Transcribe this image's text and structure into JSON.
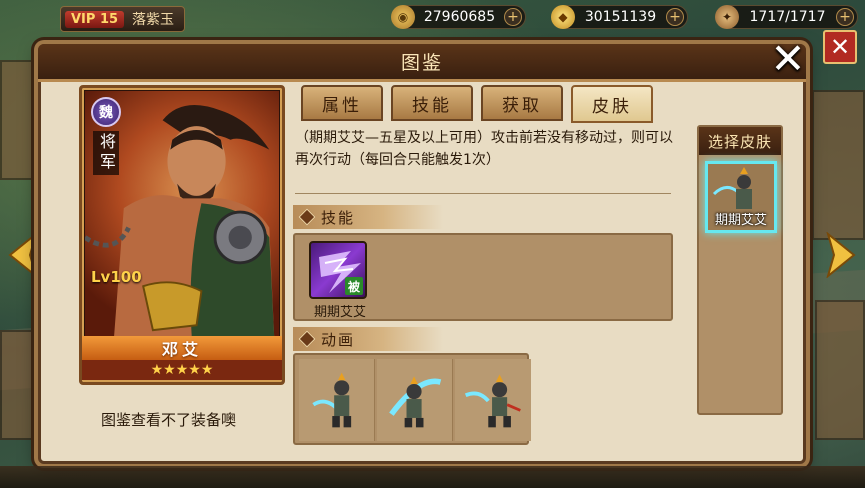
{
  "topbar": {
    "vip_label": "VIP 15",
    "player_name": "落紫玉",
    "resources": [
      {
        "icon": "coin-icon",
        "value": "27960685",
        "color": "#c99a3a"
      },
      {
        "icon": "gold-ingot-icon",
        "value": "30151139",
        "color": "#e8c040"
      },
      {
        "icon": "stamina-icon",
        "value": "1717/1717",
        "color": "#d0a060"
      }
    ]
  },
  "modal": {
    "title": "图鉴",
    "close_glyph": "✕"
  },
  "hero": {
    "faction": "魏",
    "rank": "将军",
    "level": "Lv100",
    "name": "邓艾",
    "stars": "★★★★★",
    "star_count": 5,
    "equip_note": "图鉴查看不了装备噢"
  },
  "tabs": [
    {
      "label": "属性",
      "active": false
    },
    {
      "label": "技能",
      "active": false
    },
    {
      "label": "获取",
      "active": false
    },
    {
      "label": "皮肤",
      "active": true
    }
  ],
  "skin_description": "（期期艾艾—五星及以上可用）攻击前若没有移动过，则可以再次行动（每回合只能触发1次）",
  "skills_section": {
    "label": "技能",
    "items": [
      {
        "name": "期期艾艾",
        "badge": "被"
      }
    ]
  },
  "animation_section": {
    "label": "动画"
  },
  "skin_selector": {
    "header": "选择皮肤",
    "items": [
      {
        "name": "期期艾艾",
        "selected": true
      }
    ]
  },
  "colors": {
    "accent": "#c65d12",
    "selected_glow": "#66e8f0",
    "frame_brown": "#5a3418"
  }
}
